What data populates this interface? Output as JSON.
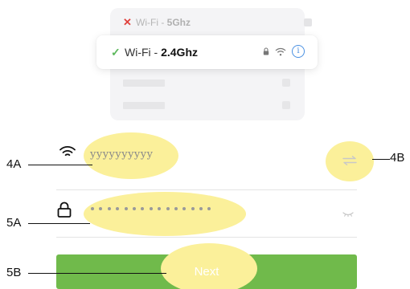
{
  "wifi_list": {
    "unavailable_network": {
      "prefix": "Wi-Fi - ",
      "band": "5Ghz"
    },
    "selected_network": {
      "prefix": "Wi-Fi - ",
      "band": "2.4Ghz"
    },
    "icons": [
      "close-icon",
      "check-icon",
      "lock-icon",
      "wifi-signal-icon",
      "info-icon"
    ]
  },
  "form": {
    "ssid_value": "yyyyyyyyyy",
    "password_mask_length": 15,
    "next_label": "Next"
  },
  "callouts": {
    "ssid": "4A",
    "switch": "4B",
    "password": "5A",
    "next": "5B"
  },
  "colors": {
    "accent_green": "#70ba4b",
    "highlight": "#fbf09a",
    "error_red": "#e0413c",
    "info_blue": "#4a90e2"
  }
}
